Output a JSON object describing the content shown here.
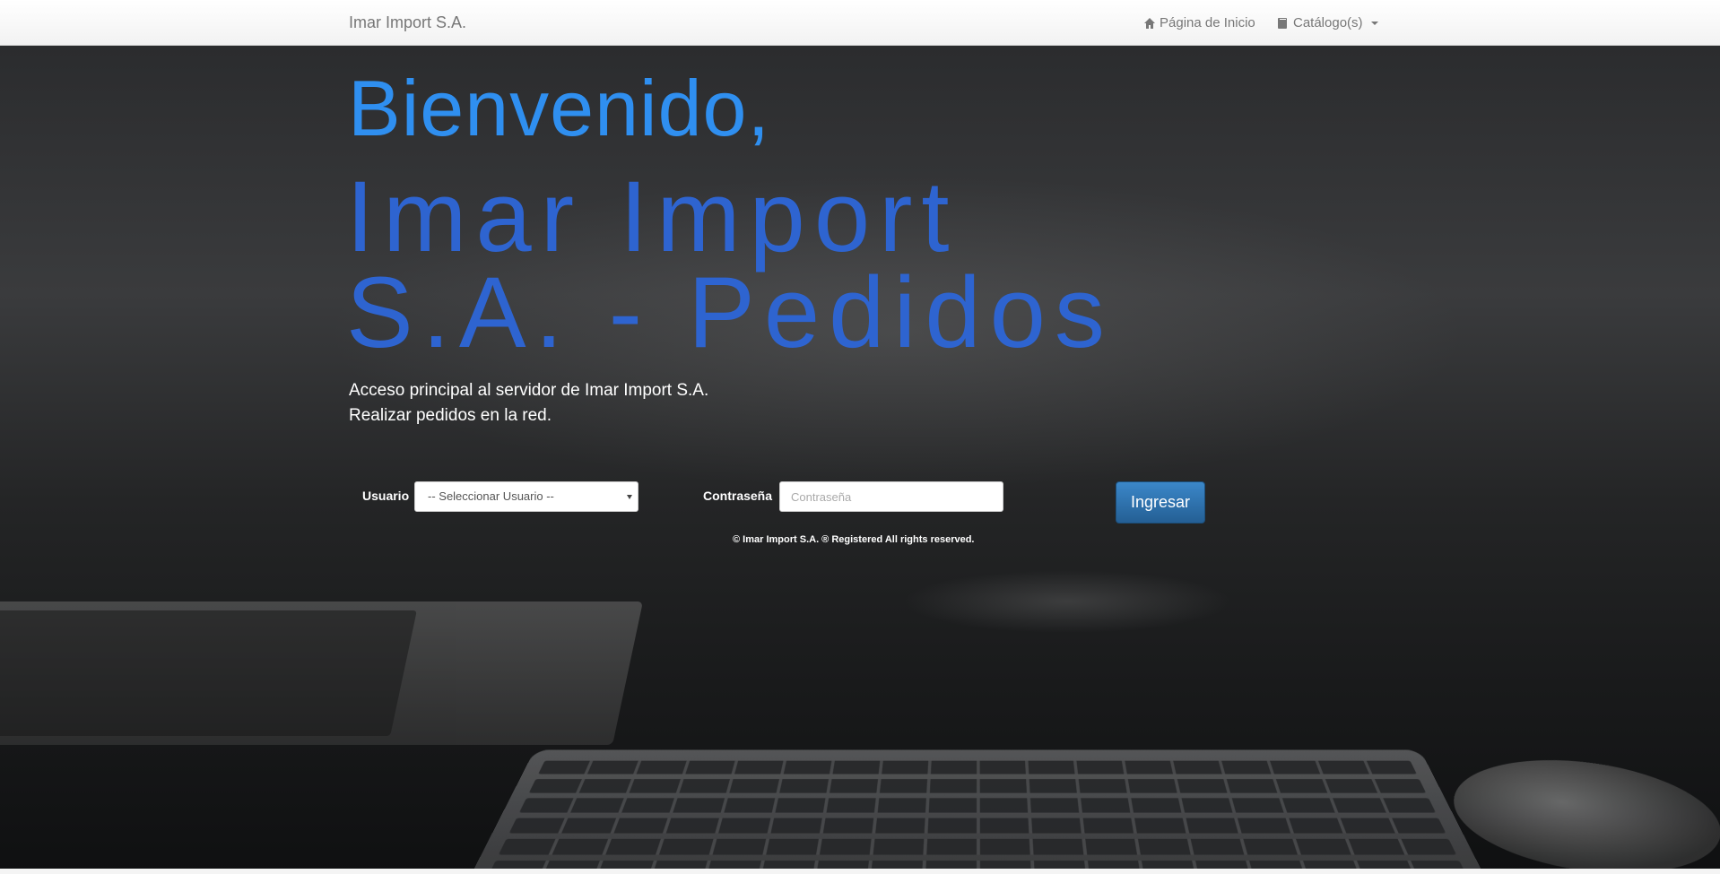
{
  "navbar": {
    "brand": "Imar Import S.A.",
    "home_label": "Página de Inicio",
    "home_icon": "home-icon",
    "catalog_label": "Catálogo(s)",
    "catalog_icon": "book-icon"
  },
  "hero": {
    "welcome": "Bienvenido,",
    "title": "Imar Import S.A. - Pedidos",
    "description_line1": "Acceso principal al servidor de Imar Import S.A.",
    "description_line2": "Realizar pedidos en la red."
  },
  "login": {
    "user_label": "Usuario",
    "user_select_value": "-- Seleccionar Usuario --",
    "password_label": "Contraseña",
    "password_placeholder": "Contraseña",
    "submit_label": "Ingresar"
  },
  "footer": {
    "text": "© Imar Import S.A. ® Registered All rights reserved."
  },
  "colors": {
    "welcome": "#2f8ff0",
    "title": "#2e64d0",
    "button": "#2a6ead"
  }
}
